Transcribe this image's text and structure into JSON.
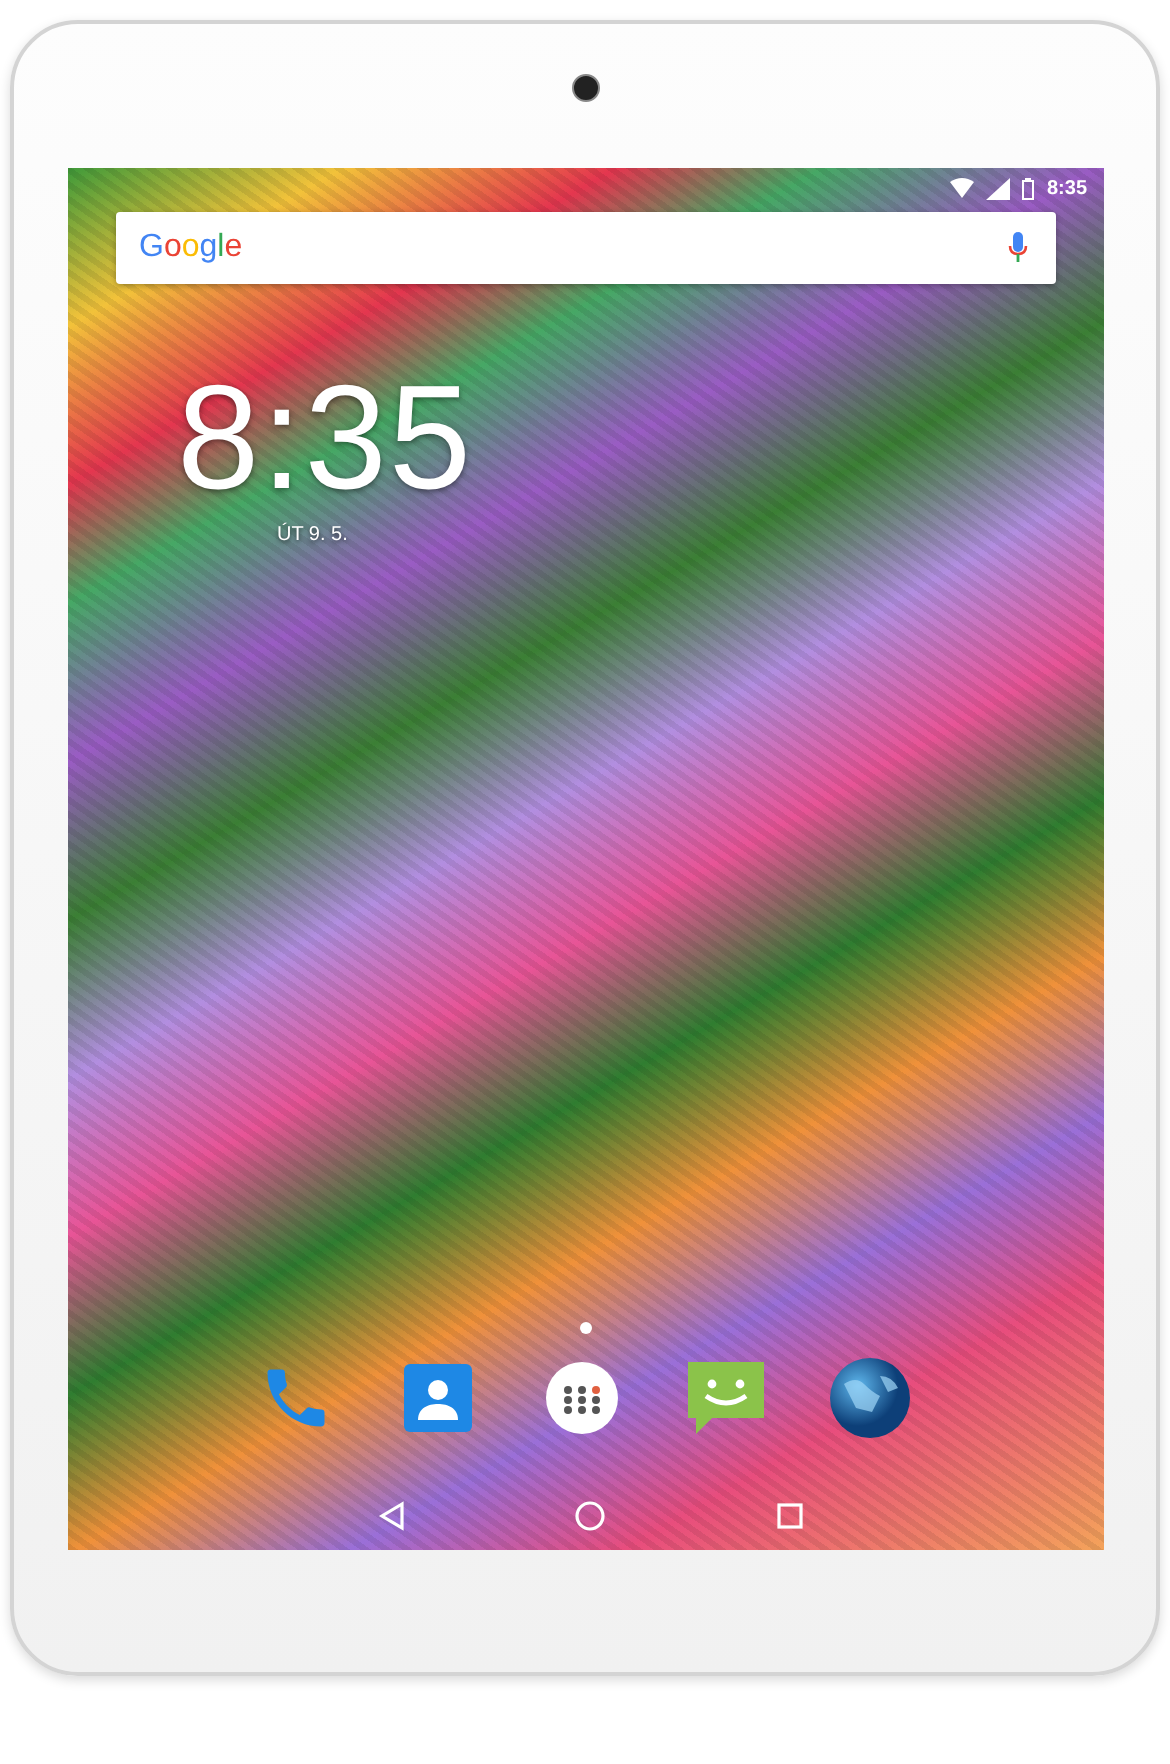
{
  "status_bar": {
    "time": "8:35"
  },
  "search_bar": {
    "logo": "Google"
  },
  "clock_widget": {
    "time": "8:35",
    "date": "ÚT 9. 5."
  },
  "dock": {
    "apps": [
      {
        "kind": "phone"
      },
      {
        "kind": "contacts"
      },
      {
        "kind": "apps"
      },
      {
        "kind": "messages"
      },
      {
        "kind": "browser"
      }
    ]
  },
  "navigation_bar": {
    "buttons": [
      {
        "kind": "back"
      },
      {
        "kind": "home"
      },
      {
        "kind": "recents"
      }
    ]
  }
}
